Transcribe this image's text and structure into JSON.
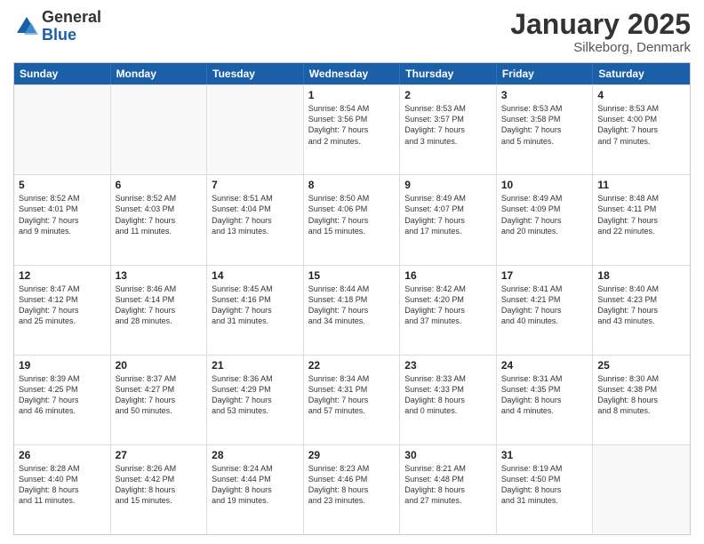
{
  "logo": {
    "general": "General",
    "blue": "Blue"
  },
  "header": {
    "title": "January 2025",
    "location": "Silkeborg, Denmark"
  },
  "weekdays": [
    "Sunday",
    "Monday",
    "Tuesday",
    "Wednesday",
    "Thursday",
    "Friday",
    "Saturday"
  ],
  "rows": [
    [
      {
        "day": "",
        "text": ""
      },
      {
        "day": "",
        "text": ""
      },
      {
        "day": "",
        "text": ""
      },
      {
        "day": "1",
        "text": "Sunrise: 8:54 AM\nSunset: 3:56 PM\nDaylight: 7 hours\nand 2 minutes."
      },
      {
        "day": "2",
        "text": "Sunrise: 8:53 AM\nSunset: 3:57 PM\nDaylight: 7 hours\nand 3 minutes."
      },
      {
        "day": "3",
        "text": "Sunrise: 8:53 AM\nSunset: 3:58 PM\nDaylight: 7 hours\nand 5 minutes."
      },
      {
        "day": "4",
        "text": "Sunrise: 8:53 AM\nSunset: 4:00 PM\nDaylight: 7 hours\nand 7 minutes."
      }
    ],
    [
      {
        "day": "5",
        "text": "Sunrise: 8:52 AM\nSunset: 4:01 PM\nDaylight: 7 hours\nand 9 minutes."
      },
      {
        "day": "6",
        "text": "Sunrise: 8:52 AM\nSunset: 4:03 PM\nDaylight: 7 hours\nand 11 minutes."
      },
      {
        "day": "7",
        "text": "Sunrise: 8:51 AM\nSunset: 4:04 PM\nDaylight: 7 hours\nand 13 minutes."
      },
      {
        "day": "8",
        "text": "Sunrise: 8:50 AM\nSunset: 4:06 PM\nDaylight: 7 hours\nand 15 minutes."
      },
      {
        "day": "9",
        "text": "Sunrise: 8:49 AM\nSunset: 4:07 PM\nDaylight: 7 hours\nand 17 minutes."
      },
      {
        "day": "10",
        "text": "Sunrise: 8:49 AM\nSunset: 4:09 PM\nDaylight: 7 hours\nand 20 minutes."
      },
      {
        "day": "11",
        "text": "Sunrise: 8:48 AM\nSunset: 4:11 PM\nDaylight: 7 hours\nand 22 minutes."
      }
    ],
    [
      {
        "day": "12",
        "text": "Sunrise: 8:47 AM\nSunset: 4:12 PM\nDaylight: 7 hours\nand 25 minutes."
      },
      {
        "day": "13",
        "text": "Sunrise: 8:46 AM\nSunset: 4:14 PM\nDaylight: 7 hours\nand 28 minutes."
      },
      {
        "day": "14",
        "text": "Sunrise: 8:45 AM\nSunset: 4:16 PM\nDaylight: 7 hours\nand 31 minutes."
      },
      {
        "day": "15",
        "text": "Sunrise: 8:44 AM\nSunset: 4:18 PM\nDaylight: 7 hours\nand 34 minutes."
      },
      {
        "day": "16",
        "text": "Sunrise: 8:42 AM\nSunset: 4:20 PM\nDaylight: 7 hours\nand 37 minutes."
      },
      {
        "day": "17",
        "text": "Sunrise: 8:41 AM\nSunset: 4:21 PM\nDaylight: 7 hours\nand 40 minutes."
      },
      {
        "day": "18",
        "text": "Sunrise: 8:40 AM\nSunset: 4:23 PM\nDaylight: 7 hours\nand 43 minutes."
      }
    ],
    [
      {
        "day": "19",
        "text": "Sunrise: 8:39 AM\nSunset: 4:25 PM\nDaylight: 7 hours\nand 46 minutes."
      },
      {
        "day": "20",
        "text": "Sunrise: 8:37 AM\nSunset: 4:27 PM\nDaylight: 7 hours\nand 50 minutes."
      },
      {
        "day": "21",
        "text": "Sunrise: 8:36 AM\nSunset: 4:29 PM\nDaylight: 7 hours\nand 53 minutes."
      },
      {
        "day": "22",
        "text": "Sunrise: 8:34 AM\nSunset: 4:31 PM\nDaylight: 7 hours\nand 57 minutes."
      },
      {
        "day": "23",
        "text": "Sunrise: 8:33 AM\nSunset: 4:33 PM\nDaylight: 8 hours\nand 0 minutes."
      },
      {
        "day": "24",
        "text": "Sunrise: 8:31 AM\nSunset: 4:35 PM\nDaylight: 8 hours\nand 4 minutes."
      },
      {
        "day": "25",
        "text": "Sunrise: 8:30 AM\nSunset: 4:38 PM\nDaylight: 8 hours\nand 8 minutes."
      }
    ],
    [
      {
        "day": "26",
        "text": "Sunrise: 8:28 AM\nSunset: 4:40 PM\nDaylight: 8 hours\nand 11 minutes."
      },
      {
        "day": "27",
        "text": "Sunrise: 8:26 AM\nSunset: 4:42 PM\nDaylight: 8 hours\nand 15 minutes."
      },
      {
        "day": "28",
        "text": "Sunrise: 8:24 AM\nSunset: 4:44 PM\nDaylight: 8 hours\nand 19 minutes."
      },
      {
        "day": "29",
        "text": "Sunrise: 8:23 AM\nSunset: 4:46 PM\nDaylight: 8 hours\nand 23 minutes."
      },
      {
        "day": "30",
        "text": "Sunrise: 8:21 AM\nSunset: 4:48 PM\nDaylight: 8 hours\nand 27 minutes."
      },
      {
        "day": "31",
        "text": "Sunrise: 8:19 AM\nSunset: 4:50 PM\nDaylight: 8 hours\nand 31 minutes."
      },
      {
        "day": "",
        "text": ""
      }
    ]
  ]
}
